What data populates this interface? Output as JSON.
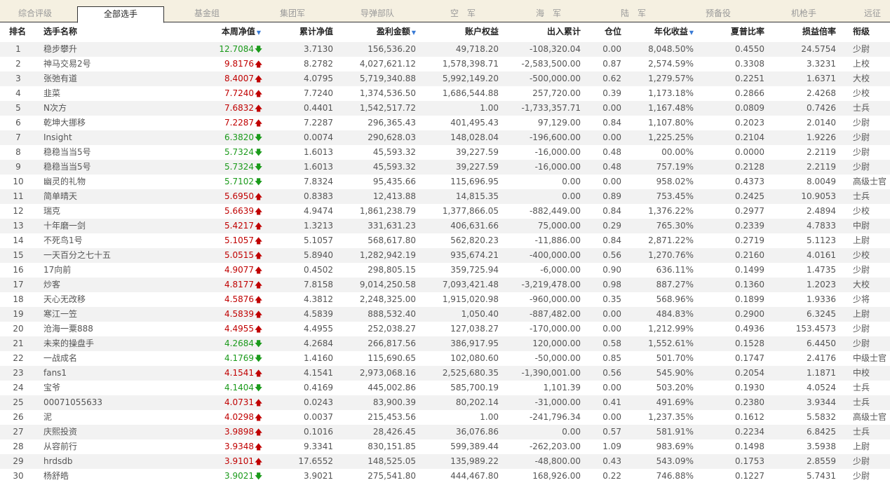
{
  "tabs": [
    {
      "label": "综合评级",
      "active": false
    },
    {
      "label": "全部选手",
      "active": true
    },
    {
      "label": "基金组",
      "active": false
    },
    {
      "label": "集团军",
      "active": false
    },
    {
      "label": "导弹部队",
      "active": false
    },
    {
      "label": "空　军",
      "active": false
    },
    {
      "label": "海　军",
      "active": false
    },
    {
      "label": "陆　军",
      "active": false
    },
    {
      "label": "预备役",
      "active": false
    },
    {
      "label": "机枪手",
      "active": false
    },
    {
      "label": "远征",
      "active": false
    }
  ],
  "columns": {
    "rank": "排名",
    "name": "选手名称",
    "week_nav": "本周净值",
    "cum_nav": "累计净值",
    "profit": "盈利金额",
    "equity": "账户权益",
    "flow": "出入累计",
    "position": "仓位",
    "annual": "年化收益",
    "sharpe": "夏普比率",
    "pl_ratio": "损益倍率",
    "rank_title": "衔级"
  },
  "sort_icon": "▼",
  "arrows": {
    "up": "🡅",
    "down": "🡇"
  },
  "colors": {
    "up": "#c00000",
    "down": "#1a9a1a",
    "sort": "#3a7bd5"
  },
  "rows": [
    {
      "rank": "1",
      "name": "稳步攀升",
      "week_nav": "12.7084",
      "trend": "down",
      "cum_nav": "3.7130",
      "profit": "156,536.20",
      "equity": "49,718.20",
      "flow": "-108,320.04",
      "position": "0.00",
      "annual": "8,048.50%",
      "sharpe": "0.4550",
      "pl_ratio": "24.5754",
      "title": "少尉"
    },
    {
      "rank": "2",
      "name": "神马交易2号",
      "week_nav": "9.8176",
      "trend": "up",
      "cum_nav": "8.2782",
      "profit": "4,027,621.12",
      "equity": "1,578,398.71",
      "flow": "-2,583,500.00",
      "position": "0.87",
      "annual": "2,574.59%",
      "sharpe": "0.3308",
      "pl_ratio": "3.3231",
      "title": "上校"
    },
    {
      "rank": "3",
      "name": "张弛有道",
      "week_nav": "8.4007",
      "trend": "up",
      "cum_nav": "4.0795",
      "profit": "5,719,340.88",
      "equity": "5,992,149.20",
      "flow": "-500,000.00",
      "position": "0.62",
      "annual": "1,279.57%",
      "sharpe": "0.2251",
      "pl_ratio": "1.6371",
      "title": "大校"
    },
    {
      "rank": "4",
      "name": "韭菜",
      "week_nav": "7.7240",
      "trend": "up",
      "cum_nav": "7.7240",
      "profit": "1,374,536.50",
      "equity": "1,686,544.88",
      "flow": "257,720.00",
      "position": "0.39",
      "annual": "1,173.18%",
      "sharpe": "0.2866",
      "pl_ratio": "2.4268",
      "title": "少校"
    },
    {
      "rank": "5",
      "name": "N次方",
      "week_nav": "7.6832",
      "trend": "up",
      "cum_nav": "0.4401",
      "profit": "1,542,517.72",
      "equity": "1.00",
      "flow": "-1,733,357.71",
      "position": "0.00",
      "annual": "1,167.48%",
      "sharpe": "0.0809",
      "pl_ratio": "0.7426",
      "title": "士兵"
    },
    {
      "rank": "6",
      "name": "乾坤大挪移",
      "week_nav": "7.2287",
      "trend": "up",
      "cum_nav": "7.2287",
      "profit": "296,365.43",
      "equity": "401,495.43",
      "flow": "97,129.00",
      "position": "0.84",
      "annual": "1,107.80%",
      "sharpe": "0.2023",
      "pl_ratio": "2.0140",
      "title": "少尉"
    },
    {
      "rank": "7",
      "name": "Insight",
      "week_nav": "6.3820",
      "trend": "down",
      "cum_nav": "0.0074",
      "profit": "290,628.03",
      "equity": "148,028.04",
      "flow": "-196,600.00",
      "position": "0.00",
      "annual": "1,225.25%",
      "sharpe": "0.2104",
      "pl_ratio": "1.9226",
      "title": "少尉"
    },
    {
      "rank": "8",
      "name": "稳稳当当5号",
      "week_nav": "5.7324",
      "trend": "down",
      "cum_nav": "1.6013",
      "profit": "45,593.32",
      "equity": "39,227.59",
      "flow": "-16,000.00",
      "position": "0.48",
      "annual": "00.00%",
      "sharpe": "0.0000",
      "pl_ratio": "2.2119",
      "title": "少尉"
    },
    {
      "rank": "9",
      "name": "稳稳当当5号",
      "week_nav": "5.7324",
      "trend": "down",
      "cum_nav": "1.6013",
      "profit": "45,593.32",
      "equity": "39,227.59",
      "flow": "-16,000.00",
      "position": "0.48",
      "annual": "757.19%",
      "sharpe": "0.2128",
      "pl_ratio": "2.2119",
      "title": "少尉"
    },
    {
      "rank": "10",
      "name": "幽灵的礼物",
      "week_nav": "5.7102",
      "trend": "down",
      "cum_nav": "7.8324",
      "profit": "95,435.66",
      "equity": "115,696.95",
      "flow": "0.00",
      "position": "0.00",
      "annual": "958.02%",
      "sharpe": "0.4373",
      "pl_ratio": "8.0049",
      "title": "高级士官"
    },
    {
      "rank": "11",
      "name": "简单晴天",
      "week_nav": "5.6950",
      "trend": "up",
      "cum_nav": "0.8383",
      "profit": "12,413.88",
      "equity": "14,815.35",
      "flow": "0.00",
      "position": "0.89",
      "annual": "753.45%",
      "sharpe": "0.2425",
      "pl_ratio": "10.9053",
      "title": "士兵"
    },
    {
      "rank": "12",
      "name": "瑞克",
      "week_nav": "5.6639",
      "trend": "up",
      "cum_nav": "4.9474",
      "profit": "1,861,238.79",
      "equity": "1,377,866.05",
      "flow": "-882,449.00",
      "position": "0.84",
      "annual": "1,376.22%",
      "sharpe": "0.2977",
      "pl_ratio": "2.4894",
      "title": "少校"
    },
    {
      "rank": "13",
      "name": "十年磨一剑",
      "week_nav": "5.4217",
      "trend": "up",
      "cum_nav": "1.3213",
      "profit": "331,631.23",
      "equity": "406,631.66",
      "flow": "75,000.00",
      "position": "0.29",
      "annual": "765.30%",
      "sharpe": "0.2339",
      "pl_ratio": "4.7833",
      "title": "中尉"
    },
    {
      "rank": "14",
      "name": "不死鸟1号",
      "week_nav": "5.1057",
      "trend": "up",
      "cum_nav": "5.1057",
      "profit": "568,617.80",
      "equity": "562,820.23",
      "flow": "-11,886.00",
      "position": "0.84",
      "annual": "2,871.22%",
      "sharpe": "0.2719",
      "pl_ratio": "5.1123",
      "title": "上尉"
    },
    {
      "rank": "15",
      "name": "一天百分之七十五",
      "week_nav": "5.0515",
      "trend": "up",
      "cum_nav": "5.8940",
      "profit": "1,282,942.19",
      "equity": "935,674.21",
      "flow": "-400,000.00",
      "position": "0.56",
      "annual": "1,270.76%",
      "sharpe": "0.2160",
      "pl_ratio": "4.0161",
      "title": "少校"
    },
    {
      "rank": "16",
      "name": "17向前",
      "week_nav": "4.9077",
      "trend": "up",
      "cum_nav": "0.4502",
      "profit": "298,805.15",
      "equity": "359,725.94",
      "flow": "-6,000.00",
      "position": "0.90",
      "annual": "636.11%",
      "sharpe": "0.1499",
      "pl_ratio": "1.4735",
      "title": "少尉"
    },
    {
      "rank": "17",
      "name": "炒客",
      "week_nav": "4.8177",
      "trend": "up",
      "cum_nav": "7.8158",
      "profit": "9,014,250.58",
      "equity": "7,093,421.48",
      "flow": "-3,219,478.00",
      "position": "0.98",
      "annual": "887.27%",
      "sharpe": "0.1360",
      "pl_ratio": "1.2023",
      "title": "大校"
    },
    {
      "rank": "18",
      "name": "天心无改移",
      "week_nav": "4.5876",
      "trend": "up",
      "cum_nav": "4.3812",
      "profit": "2,248,325.00",
      "equity": "1,915,020.98",
      "flow": "-960,000.00",
      "position": "0.35",
      "annual": "568.96%",
      "sharpe": "0.1899",
      "pl_ratio": "1.9336",
      "title": "少将"
    },
    {
      "rank": "19",
      "name": "寒江一笠",
      "week_nav": "4.5839",
      "trend": "up",
      "cum_nav": "4.5839",
      "profit": "888,532.40",
      "equity": "1,050.40",
      "flow": "-887,482.00",
      "position": "0.00",
      "annual": "484.83%",
      "sharpe": "0.2900",
      "pl_ratio": "6.3245",
      "title": "上尉"
    },
    {
      "rank": "20",
      "name": "沧海一粟888",
      "week_nav": "4.4955",
      "trend": "up",
      "cum_nav": "4.4955",
      "profit": "252,038.27",
      "equity": "127,038.27",
      "flow": "-170,000.00",
      "position": "0.00",
      "annual": "1,212.99%",
      "sharpe": "0.4936",
      "pl_ratio": "153.4573",
      "title": "少尉"
    },
    {
      "rank": "21",
      "name": "未来的操盘手",
      "week_nav": "4.2684",
      "trend": "down",
      "cum_nav": "4.2684",
      "profit": "266,817.56",
      "equity": "386,917.95",
      "flow": "120,000.00",
      "position": "0.58",
      "annual": "1,552.61%",
      "sharpe": "0.1528",
      "pl_ratio": "6.4450",
      "title": "少尉"
    },
    {
      "rank": "22",
      "name": "一战成名",
      "week_nav": "4.1769",
      "trend": "down",
      "cum_nav": "1.4160",
      "profit": "115,690.65",
      "equity": "102,080.60",
      "flow": "-50,000.00",
      "position": "0.85",
      "annual": "501.70%",
      "sharpe": "0.1747",
      "pl_ratio": "2.4176",
      "title": "中级士官"
    },
    {
      "rank": "23",
      "name": "fans1",
      "week_nav": "4.1541",
      "trend": "up",
      "cum_nav": "4.1541",
      "profit": "2,973,068.16",
      "equity": "2,525,680.35",
      "flow": "-1,390,001.00",
      "position": "0.56",
      "annual": "545.90%",
      "sharpe": "0.2054",
      "pl_ratio": "1.1871",
      "title": "中校"
    },
    {
      "rank": "24",
      "name": "宝爷",
      "week_nav": "4.1404",
      "trend": "down",
      "cum_nav": "0.4169",
      "profit": "445,002.86",
      "equity": "585,700.19",
      "flow": "1,101.39",
      "position": "0.00",
      "annual": "503.20%",
      "sharpe": "0.1930",
      "pl_ratio": "4.0524",
      "title": "士兵"
    },
    {
      "rank": "25",
      "name": "00071055633",
      "week_nav": "4.0731",
      "trend": "up",
      "cum_nav": "0.0243",
      "profit": "83,900.39",
      "equity": "80,202.14",
      "flow": "-31,000.00",
      "position": "0.41",
      "annual": "491.69%",
      "sharpe": "0.2380",
      "pl_ratio": "3.9344",
      "title": "士兵"
    },
    {
      "rank": "26",
      "name": "泥",
      "week_nav": "4.0298",
      "trend": "up",
      "cum_nav": "0.0037",
      "profit": "215,453.56",
      "equity": "1.00",
      "flow": "-241,796.34",
      "position": "0.00",
      "annual": "1,237.35%",
      "sharpe": "0.1612",
      "pl_ratio": "5.5832",
      "title": "高级士官"
    },
    {
      "rank": "27",
      "name": "庆熙投资",
      "week_nav": "3.9898",
      "trend": "up",
      "cum_nav": "0.1016",
      "profit": "28,426.45",
      "equity": "36,076.86",
      "flow": "0.00",
      "position": "0.57",
      "annual": "581.91%",
      "sharpe": "0.2234",
      "pl_ratio": "6.8425",
      "title": "士兵"
    },
    {
      "rank": "28",
      "name": "从容前行",
      "week_nav": "3.9348",
      "trend": "up",
      "cum_nav": "9.3341",
      "profit": "830,151.85",
      "equity": "599,389.44",
      "flow": "-262,203.00",
      "position": "1.09",
      "annual": "983.69%",
      "sharpe": "0.1498",
      "pl_ratio": "3.5938",
      "title": "上尉"
    },
    {
      "rank": "29",
      "name": "hrdsdb",
      "week_nav": "3.9101",
      "trend": "up",
      "cum_nav": "17.6552",
      "profit": "148,525.05",
      "equity": "135,989.22",
      "flow": "-48,800.00",
      "position": "0.43",
      "annual": "543.09%",
      "sharpe": "0.1753",
      "pl_ratio": "2.8559",
      "title": "少尉"
    },
    {
      "rank": "30",
      "name": "杨舒皓",
      "week_nav": "3.9021",
      "trend": "down",
      "cum_nav": "3.9021",
      "profit": "275,541.80",
      "equity": "444,467.80",
      "flow": "168,926.00",
      "position": "0.22",
      "annual": "746.88%",
      "sharpe": "0.1227",
      "pl_ratio": "5.7431",
      "title": "少尉"
    }
  ]
}
